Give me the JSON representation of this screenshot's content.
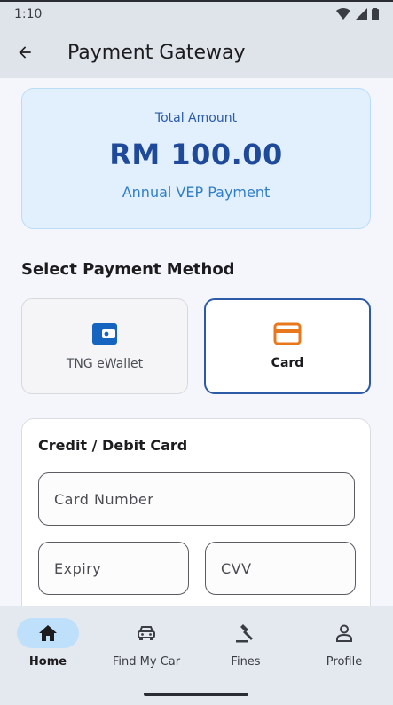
{
  "status": {
    "time": "1:10"
  },
  "app_bar": {
    "title": "Payment Gateway"
  },
  "amount_card": {
    "label": "Total Amount",
    "value": "RM 100.00",
    "subtitle": "Annual VEP Payment"
  },
  "payment_method": {
    "title": "Select Payment Method",
    "options": [
      {
        "label": "TNG eWallet",
        "icon": "wallet-icon",
        "selected": false
      },
      {
        "label": "Card",
        "icon": "credit-card-icon",
        "selected": true
      }
    ]
  },
  "card_form": {
    "title": "Credit / Debit Card",
    "card_number_placeholder": "Card Number",
    "expiry_placeholder": "Expiry",
    "cvv_placeholder": "CVV"
  },
  "bottom_nav": {
    "items": [
      {
        "label": "Home",
        "icon": "home-icon",
        "active": true
      },
      {
        "label": "Find My Car",
        "icon": "car-icon",
        "active": false
      },
      {
        "label": "Fines",
        "icon": "gavel-icon",
        "active": false
      },
      {
        "label": "Profile",
        "icon": "person-icon",
        "active": false
      }
    ]
  },
  "colors": {
    "primary": "#1f4a9a",
    "accent_orange": "#e8781c",
    "wallet_blue": "#1565c0",
    "selected_border": "#2c5aa6"
  }
}
